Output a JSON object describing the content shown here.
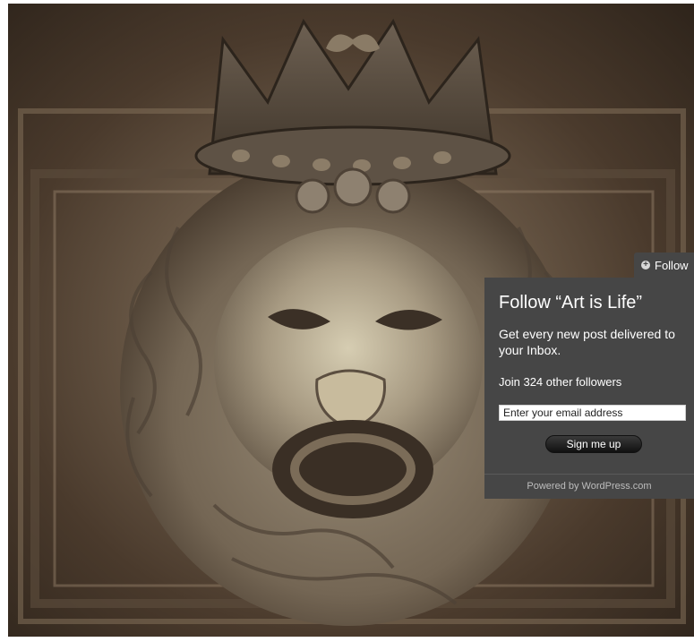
{
  "photo": {
    "subject_icon": "lion-door-knocker-image"
  },
  "follow_tab": {
    "label": "Follow",
    "icon": "plus-circle-icon"
  },
  "follow_panel": {
    "title": "Follow “Art is Life”",
    "description": "Get every new post delivered to your Inbox.",
    "join_text": "Join 324 other followers",
    "email_placeholder": "Enter your email address",
    "signup_label": "Sign me up",
    "powered_by": "Powered by WordPress.com"
  },
  "colors": {
    "panel_bg": "#464646",
    "panel_text": "#ffffff",
    "footer_text": "#bdbdbd"
  }
}
